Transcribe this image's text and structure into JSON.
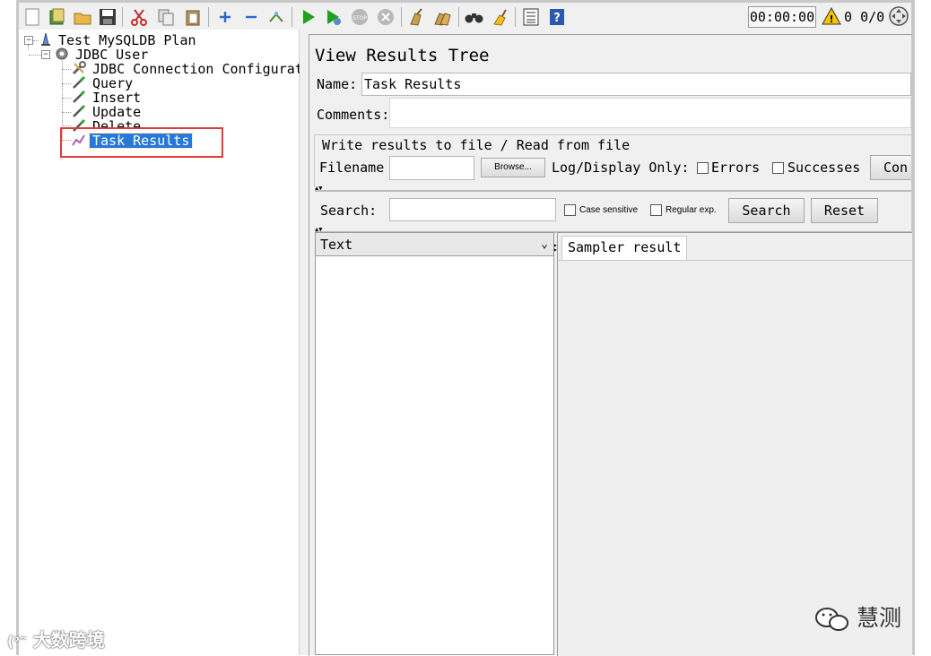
{
  "toolbar": {
    "buttons": [
      "new-icon",
      "templates-icon",
      "open-icon",
      "save-icon",
      "cut-icon",
      "copy-icon",
      "paste-icon",
      "expand-icon",
      "collapse-icon",
      "toggle-icon",
      "start-icon",
      "start-no-pause-icon",
      "stop-icon",
      "shutdown-icon",
      "clear-icon",
      "clear-all-icon",
      "search-icon",
      "reset-search-icon",
      "function-helper-icon",
      "help-icon"
    ],
    "timer": "00:00:00",
    "warning_count": "0",
    "threads": "0/0"
  },
  "tree": {
    "root": "Test MySQLDB Plan",
    "thread_group": "JDBC User",
    "children": [
      "JDBC Connection Configurat",
      "Query",
      "Insert",
      "Update",
      "Delete",
      "Task Results"
    ],
    "selected": "Task Results"
  },
  "panel": {
    "title": "View Results Tree",
    "name_label": "Name:",
    "name_value": "Task Results",
    "comments_label": "Comments:",
    "comments_value": "",
    "file_group_title": "Write results to file / Read from file",
    "filename_label": "Filename",
    "filename_value": "",
    "browse_label": "Browse...",
    "log_display_label": "Log/Display Only:",
    "errors_label": "Errors",
    "successes_label": "Successes",
    "configure_label": "Con",
    "search_label": "Search:",
    "search_value": "",
    "case_sensitive_label": "Case sensitive",
    "regular_exp_label": "Regular exp.",
    "search_button": "Search",
    "reset_button": "Reset",
    "renderer_selected": "Text",
    "result_tab": "Sampler result"
  },
  "watermarks": {
    "left": "大数跨境",
    "right": "慧测"
  },
  "colors": {
    "selection": "#2878d8",
    "highlight_box": "#e53838",
    "start_green": "#1fa01f"
  }
}
